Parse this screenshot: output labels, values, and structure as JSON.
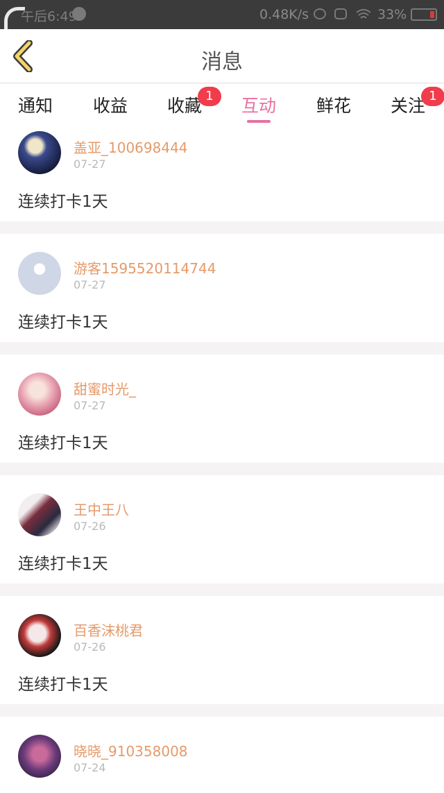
{
  "status_bar": {
    "time": "午后6:49",
    "net_speed": "0.48K/s",
    "battery": "33%"
  },
  "header": {
    "title": "消息"
  },
  "tabs": [
    {
      "label": "通知",
      "badge": ""
    },
    {
      "label": "收益",
      "badge": ""
    },
    {
      "label": "收藏",
      "badge": "1"
    },
    {
      "label": "互动",
      "badge": "",
      "active": true
    },
    {
      "label": "鲜花",
      "badge": ""
    },
    {
      "label": "关注",
      "badge": "1"
    }
  ],
  "messages": [
    {
      "name": "盖亚_100698444",
      "date": "07-27",
      "text": "连续打卡1天"
    },
    {
      "name": "游客1595520114744",
      "date": "07-27",
      "text": "连续打卡1天"
    },
    {
      "name": "甜蜜时光_",
      "date": "07-27",
      "text": "连续打卡1天"
    },
    {
      "name": "王中王八",
      "date": "07-26",
      "text": "连续打卡1天"
    },
    {
      "name": "百香沫桃君",
      "date": "07-26",
      "text": "连续打卡1天"
    },
    {
      "name": "晓晓_910358008",
      "date": "07-24",
      "text": ""
    }
  ],
  "colors": {
    "accent": "#e870a0",
    "name": "#e59a6a",
    "badge": "#f03c4b"
  }
}
